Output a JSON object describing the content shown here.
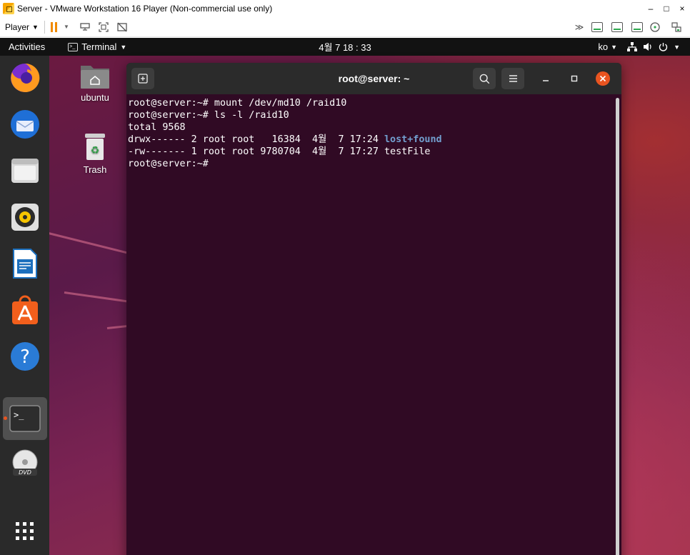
{
  "window": {
    "title": "Server - VMware Workstation 16 Player (Non-commercial use only)",
    "minimize": "–",
    "maximize": "□",
    "close": "×"
  },
  "player": {
    "menu_label": "Player",
    "icons": [
      "pause-icon",
      "send-ctrl-alt-del-icon",
      "fullscreen-icon",
      "unity-icon"
    ],
    "device_icons": [
      "more-icon",
      "hdd-icon",
      "hdd-icon",
      "hdd-icon",
      "cdrom-icon",
      "network-icon"
    ]
  },
  "topbar": {
    "activities": "Activities",
    "app_menu": "Terminal",
    "clock": "4월 7  18 : 33",
    "input_method": "ko"
  },
  "desktop": {
    "icons": [
      {
        "label": "ubuntu"
      },
      {
        "label": "Trash"
      }
    ]
  },
  "dock": {
    "apps": [
      "firefox-icon",
      "thunderbird-icon",
      "files-icon",
      "rhythmbox-icon",
      "libreoffice-writer-icon",
      "software-icon",
      "help-icon",
      "terminal-icon",
      "dvd-icon",
      "show-apps-icon"
    ]
  },
  "terminal": {
    "title": "root@server: ~",
    "lines": [
      {
        "text": "root@server:~# mount /dev/md10 /raid10"
      },
      {
        "text": "root@server:~# ls -l /raid10"
      },
      {
        "text": "total 9568"
      },
      {
        "text": "drwx------ 2 root root   16384  4월  7 17:24 ",
        "highlight": "lost+found"
      },
      {
        "text": "-rw------- 1 root root 9780704  4월  7 17:27 testFile"
      },
      {
        "text": "root@server:~#"
      }
    ]
  },
  "colors": {
    "terminal_bg": "#300a24",
    "directory_blue": "#729fcf",
    "ubuntu_orange": "#e95420"
  }
}
